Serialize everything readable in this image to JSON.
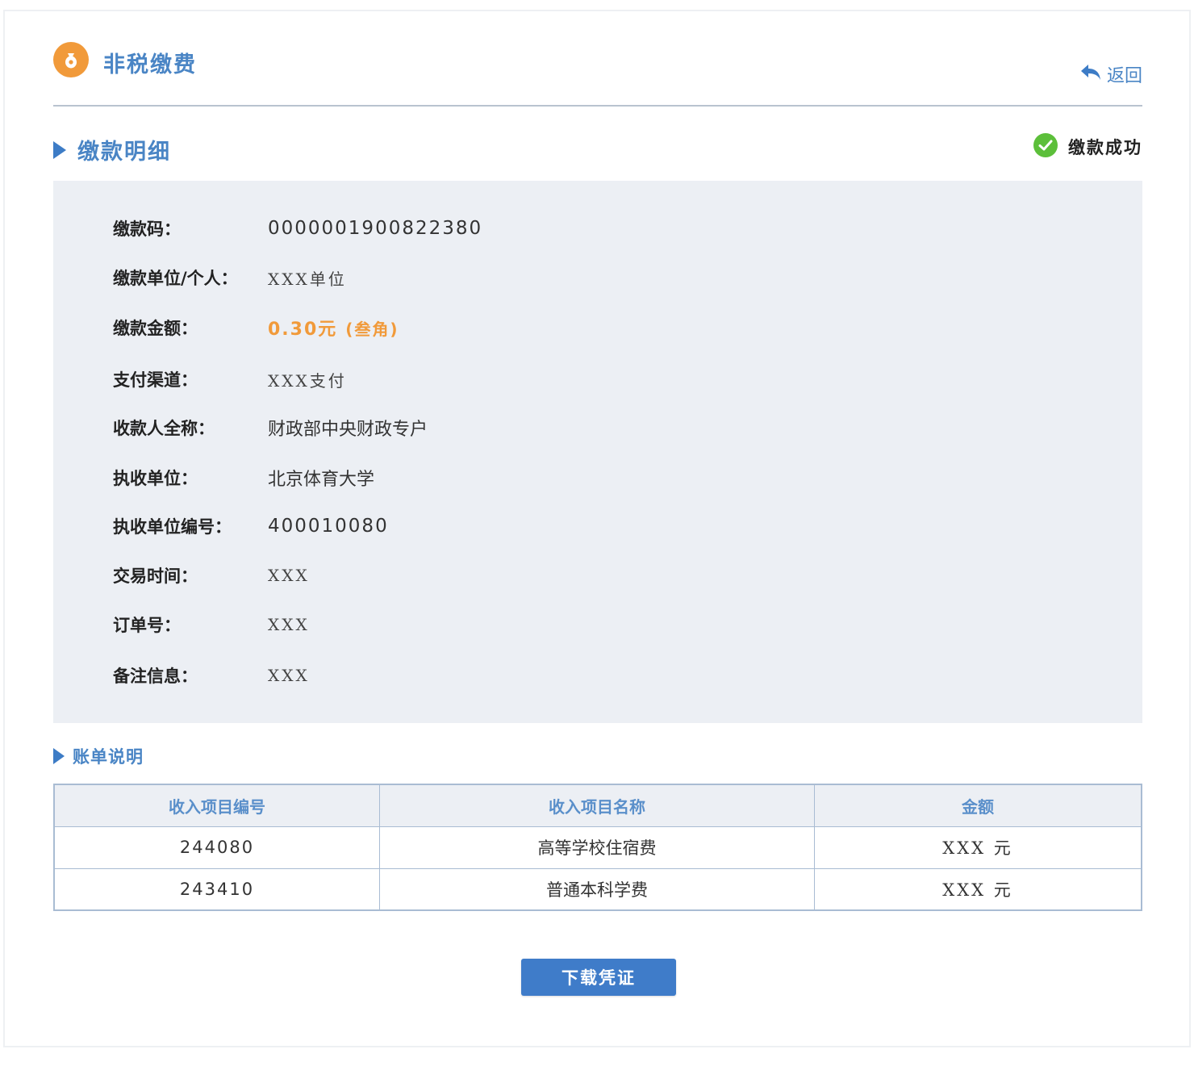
{
  "header": {
    "title": "非税缴费",
    "back_label": "返回"
  },
  "detail": {
    "section_title": "缴款明细",
    "status": "缴款成功",
    "fields": {
      "code": {
        "label": "缴款码：",
        "value": "0000001900822380"
      },
      "payer": {
        "label": "缴款单位/个人：",
        "value": "XXX单位"
      },
      "amount": {
        "label": "缴款金额：",
        "value": "0.30元",
        "value_words": "(叁角)"
      },
      "channel": {
        "label": "支付渠道：",
        "value": "XXX支付"
      },
      "payee": {
        "label": "收款人全称：",
        "value": "财政部中央财政专户"
      },
      "collector": {
        "label": "执收单位：",
        "value": "北京体育大学"
      },
      "collector_no": {
        "label": "执收单位编号：",
        "value": "400010080"
      },
      "time": {
        "label": "交易时间：",
        "value": "XXX"
      },
      "order_no": {
        "label": "订单号：",
        "value": "XXX"
      },
      "remark": {
        "label": "备注信息：",
        "value": "XXX"
      }
    }
  },
  "bill": {
    "section_title": "账单说明",
    "columns": [
      "收入项目编号",
      "收入项目名称",
      "金额"
    ],
    "rows": [
      {
        "code": "244080",
        "name": "高等学校住宿费",
        "amount": "XXX 元"
      },
      {
        "code": "243410",
        "name": "普通本科学费",
        "amount": "XXX 元"
      }
    ]
  },
  "actions": {
    "download_label": "下载凭证"
  },
  "colors": {
    "accent_blue": "#4a85c5",
    "accent_orange": "#f19a3a",
    "success_green": "#5cbf3a",
    "panel_bg": "#eceff4",
    "button_blue": "#3f7cc9"
  },
  "icons": {
    "app": "money-bag-icon",
    "back": "back-arrow-icon",
    "status": "check-circle-icon"
  }
}
